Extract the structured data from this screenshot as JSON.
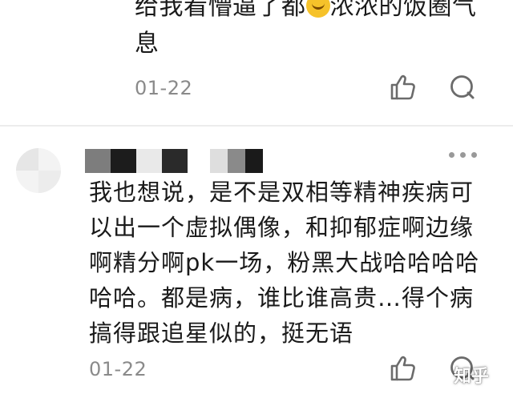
{
  "prev_comment": {
    "text_part1": "给我看懵逼了都",
    "emoji": "rofl-emoji",
    "text_part2": "浓浓的饭圈气息",
    "date": "01-22"
  },
  "comment": {
    "body": "我也想说，是不是双相等精神疾病可以出一个虚拟偶像，和抑郁症啊边缘啊精分啊pk一场，粉黑大战哈哈哈哈哈哈。都是病，谁比谁高贵…得个病搞得跟追星似的，挺无语",
    "date": "01-22"
  },
  "watermark": "知乎",
  "icons": {
    "like": "thumbs-up-icon",
    "reply": "comment-bubble-icon",
    "more": "more-dots-icon"
  },
  "colors": {
    "text": "#1a1a1a",
    "meta": "#8a8a8a",
    "icon": "#6b6b6b",
    "divider": "#ececec"
  }
}
